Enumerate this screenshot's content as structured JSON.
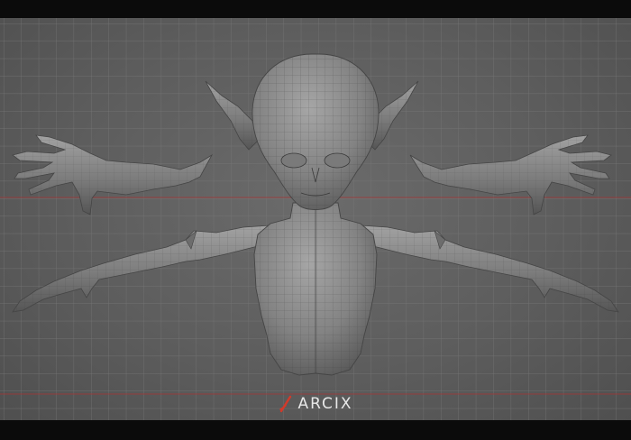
{
  "scene": {
    "subject": "creature-base-mesh",
    "background_color": "#5d5d5d",
    "letterbox_color": "#0b0b0b",
    "grid_color": "#7a7a7a",
    "mesh_fill": "#8f8f8f",
    "mesh_wire": "#3a3a3a",
    "axis_line_color": "#b03030"
  },
  "watermark": {
    "mark_icon": "slash-logo-icon",
    "mark_color": "#d23a2a",
    "text": "ARCIX"
  }
}
